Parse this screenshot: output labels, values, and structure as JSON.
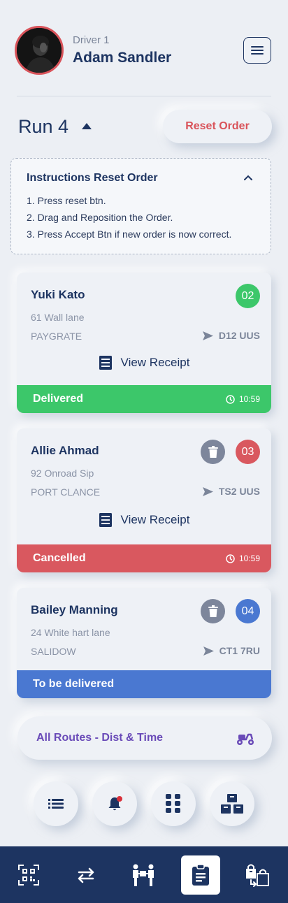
{
  "header": {
    "driver_label": "Driver 1",
    "driver_name": "Adam Sandler"
  },
  "run": {
    "title": "Run 4",
    "reset_label": "Reset Order"
  },
  "instructions": {
    "title": "Instructions Reset Order",
    "steps": [
      "1. Press reset btn.",
      "2. Drag and Reposition the Order.",
      "3. Press Accept Btn if new order is now correct."
    ]
  },
  "orders": [
    {
      "name": "Yuki Kato",
      "address": "61 Wall lane",
      "city": "PAYGRATE",
      "postcode": "D12 UUS",
      "number": "02",
      "receipt_label": "View Receipt",
      "status": "Delivered",
      "time": "10:59"
    },
    {
      "name": "Allie Ahmad",
      "address": "92 Onroad Sip",
      "city": "PORT CLANCE",
      "postcode": "TS2 UUS",
      "number": "03",
      "receipt_label": "View Receipt",
      "status": "Cancelled",
      "time": "10:59"
    },
    {
      "name": "Bailey Manning",
      "address": "24 White hart lane",
      "city": "SALIDOW",
      "postcode": "CT1 7RU",
      "number": "04",
      "status": "To be delivered"
    }
  ],
  "routes": {
    "label": "All Routes - Dist & Time"
  },
  "colors": {
    "navy": "#1d3461",
    "delivered": "#3cc76a",
    "cancelled": "#d9585f",
    "pending": "#4a78d1",
    "accent_red": "#d9535a",
    "routes_purple": "#6a4bb8"
  },
  "icons": {
    "menu": "hamburger-icon",
    "caret": "caret-up-icon",
    "chevron": "chevron-up-icon",
    "receipt": "receipt-icon",
    "send": "send-arrow-icon",
    "clock": "clock-icon",
    "trash": "trash-icon",
    "scooter": "scooter-icon",
    "list": "list-icon",
    "bell": "bell-icon",
    "grid": "grid-icon",
    "boxes": "boxes-icon",
    "qr": "qr-scan-icon",
    "swap": "swap-arrows-icon",
    "handover": "handover-icon",
    "clipboard": "clipboard-icon",
    "bag_swap": "bag-swap-icon"
  }
}
